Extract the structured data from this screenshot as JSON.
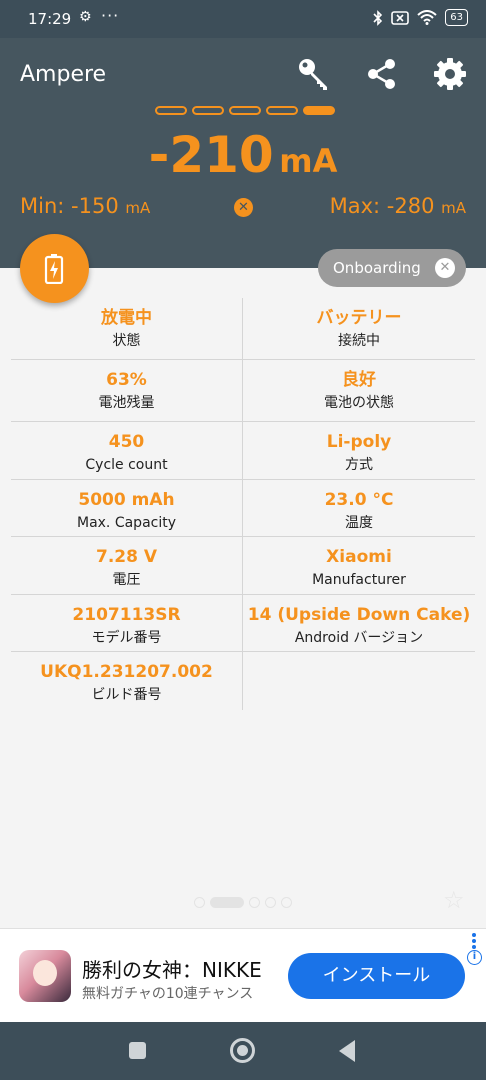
{
  "status_bar": {
    "time": "17:29",
    "menu": "···",
    "battery": "63"
  },
  "header": {
    "title": "Ampere",
    "current_value": "-210",
    "current_unit": "mA",
    "min_label": "Min: -150",
    "max_label": "Max: -280",
    "unit_small": "mA",
    "page_indicator": {
      "count": 5,
      "active": 4
    },
    "icons": [
      "key-icon",
      "share-icon",
      "gear-icon"
    ]
  },
  "chip": {
    "label": "Onboarding"
  },
  "info": {
    "rows": [
      {
        "left": {
          "value": "放電中",
          "label": "状態"
        },
        "right": {
          "value": "バッテリー",
          "label": "接続中"
        }
      },
      {
        "left": {
          "value": "63%",
          "label": "電池残量"
        },
        "right": {
          "value": "良好",
          "label": "電池の状態"
        }
      },
      {
        "left": {
          "value": "450",
          "label": "Cycle count"
        },
        "right": {
          "value": "Li-poly",
          "label": "方式"
        }
      },
      {
        "left": {
          "value": "5000 mAh",
          "label": "Max. Capacity"
        },
        "right": {
          "value": "23.0 °C",
          "label": "温度"
        }
      },
      {
        "left": {
          "value": "7.28 V",
          "label": "電圧"
        },
        "right": {
          "value": "Xiaomi",
          "label": "Manufacturer"
        }
      },
      {
        "left": {
          "value": "2107113SR",
          "label": "モデル番号"
        },
        "right": {
          "value": "14 (Upside Down Cake)",
          "label": "Android バージョン"
        }
      },
      {
        "left": {
          "value": "UKQ1.231207.002",
          "label": "ビルド番号"
        },
        "right": {
          "value": "",
          "label": ""
        }
      }
    ]
  },
  "ad": {
    "title": "勝利の女神：NIKKE",
    "subtitle": "無料ガチャの10連チャンス",
    "button": "インストール"
  },
  "colors": {
    "accent": "#f5921e",
    "header_bg": "#46565f",
    "status_bg": "#3d4e59",
    "ad_button": "#1a73e8"
  }
}
